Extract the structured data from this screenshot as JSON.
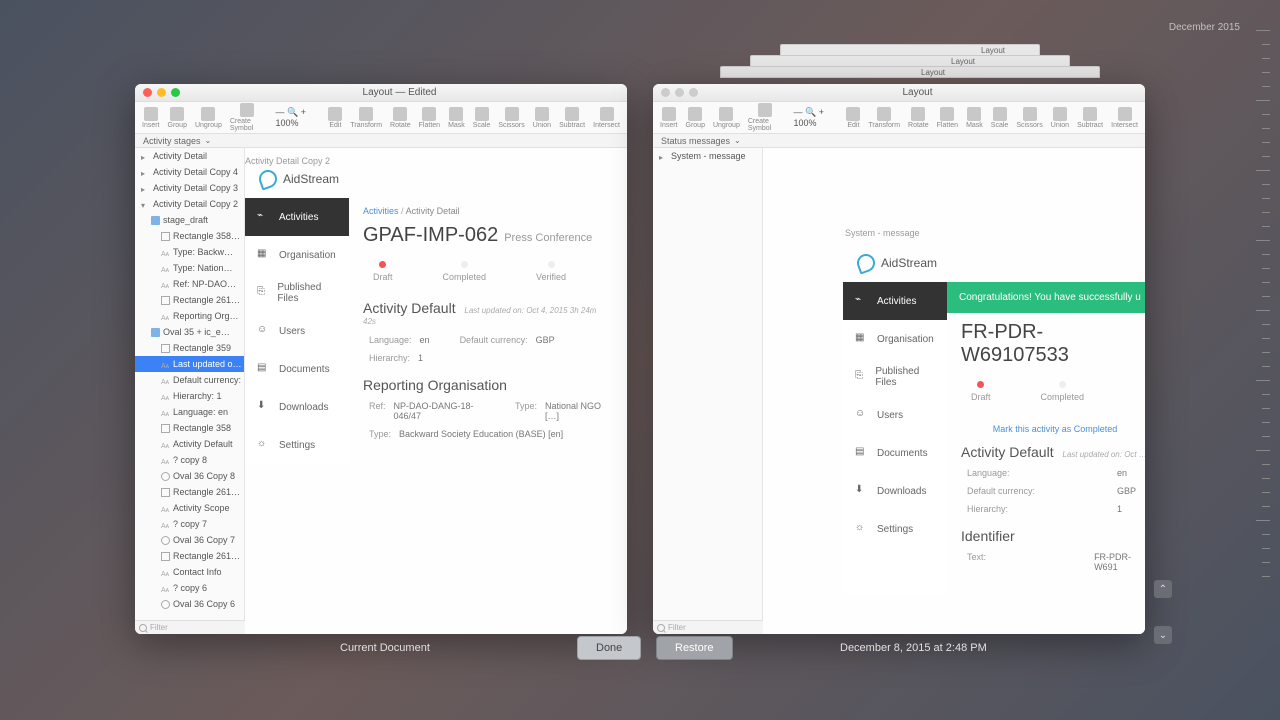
{
  "corner_date": "December 2015",
  "bg_tab_label": "Layout",
  "left_window": {
    "title": "Layout — Edited",
    "subbar": "Activity stages",
    "canvas_crumb": "Activity Detail Copy 2"
  },
  "right_window": {
    "title": "Layout",
    "subbar": "Status messages",
    "layer_root": "System - message",
    "canvas_crumb": "System - message"
  },
  "toolbar": [
    "Insert",
    "Group",
    "Ungroup",
    "Create Symbol",
    "Edit",
    "Transform",
    "Rotate",
    "Flatten",
    "Mask",
    "Scale",
    "Scissors",
    "Union",
    "Subtract",
    "Intersect"
  ],
  "zoom": "100%",
  "layers": [
    {
      "lvl": 0,
      "ic": "tri",
      "txt": "Activity Detail"
    },
    {
      "lvl": 0,
      "ic": "tri",
      "txt": "Activity Detail Copy 4"
    },
    {
      "lvl": 0,
      "ic": "tri",
      "txt": "Activity Detail Copy 3"
    },
    {
      "lvl": 0,
      "ic": "tri open",
      "txt": "Activity Detail Copy 2"
    },
    {
      "lvl": 1,
      "ic": "folder",
      "txt": "stage_draft"
    },
    {
      "lvl": 2,
      "ic": "rect",
      "txt": "Rectangle 358…"
    },
    {
      "lvl": 2,
      "ic": "text",
      "txt": "Type:   Backw…"
    },
    {
      "lvl": 2,
      "ic": "text",
      "txt": "Type:   Nation…"
    },
    {
      "lvl": 2,
      "ic": "text",
      "txt": "Ref:   NP-DAO…"
    },
    {
      "lvl": 2,
      "ic": "rect",
      "txt": "Rectangle 261…"
    },
    {
      "lvl": 2,
      "ic": "text",
      "txt": "Reporting Org…"
    },
    {
      "lvl": 1,
      "ic": "folder",
      "txt": "Oval 35 + ic_e…"
    },
    {
      "lvl": 2,
      "ic": "rect",
      "txt": "Rectangle 359"
    },
    {
      "lvl": 2,
      "ic": "text",
      "txt": "Last updated o…",
      "sel": true
    },
    {
      "lvl": 2,
      "ic": "text",
      "txt": "Default currency:"
    },
    {
      "lvl": 2,
      "ic": "text",
      "txt": "Hierarchy:   1"
    },
    {
      "lvl": 2,
      "ic": "text",
      "txt": "Language:   en"
    },
    {
      "lvl": 2,
      "ic": "rect",
      "txt": "Rectangle 358"
    },
    {
      "lvl": 2,
      "ic": "text",
      "txt": "Activity Default"
    },
    {
      "lvl": 2,
      "ic": "text",
      "txt": "? copy 8"
    },
    {
      "lvl": 2,
      "ic": "oval",
      "txt": "Oval 36 Copy 8"
    },
    {
      "lvl": 2,
      "ic": "rect",
      "txt": "Rectangle 261…"
    },
    {
      "lvl": 2,
      "ic": "text",
      "txt": "Activity Scope"
    },
    {
      "lvl": 2,
      "ic": "text",
      "txt": "? copy 7"
    },
    {
      "lvl": 2,
      "ic": "oval",
      "txt": "Oval 36 Copy 7"
    },
    {
      "lvl": 2,
      "ic": "rect",
      "txt": "Rectangle 261…"
    },
    {
      "lvl": 2,
      "ic": "text",
      "txt": "Contact Info"
    },
    {
      "lvl": 2,
      "ic": "text",
      "txt": "? copy 6"
    },
    {
      "lvl": 2,
      "ic": "oval",
      "txt": "Oval 36 Copy 6"
    }
  ],
  "filter_placeholder": "Filter",
  "brand": "AidStream",
  "nav": [
    "Activities",
    "Organisation",
    "Published Files",
    "Users",
    "Documents",
    "Downloads",
    "Settings"
  ],
  "mockup1": {
    "breadcrumb": {
      "a": "Activities",
      "b": "Activity Detail"
    },
    "title": "GPAF-IMP-062",
    "subtitle": "Press Conference",
    "stages": [
      "Draft",
      "Completed",
      "Verified"
    ],
    "active_stage": 0,
    "default_title": "Activity Default",
    "updated": "Last updated on:   Oct 4, 2015 3h 24m 42s",
    "lang_k": "Language:",
    "lang_v": "en",
    "curr_k": "Default currency:",
    "curr_v": "GBP",
    "hier_k": "Hierarchy:",
    "hier_v": "1",
    "rep_title": "Reporting Organisation",
    "ref_k": "Ref:",
    "ref_v": "NP-DAO-DANG-18-046/47",
    "type_k": "Type:",
    "type_v": "National NGO […]",
    "type2_k": "Type:",
    "type2_v": "Backward Society Education (BASE) [en]"
  },
  "mockup2": {
    "success": "Congratulations! You have successfully u",
    "title": "FR-PDR-W69107533",
    "stages": [
      "Draft",
      "Completed"
    ],
    "mark_complete": "Mark this activity as Completed",
    "default_title": "Activity Default",
    "updated": "Last updated on:   Oct …",
    "lang_k": "Language:",
    "lang_v": "en",
    "curr_k": "Default currency:",
    "curr_v": "GBP",
    "hier_k": "Hierarchy:",
    "hier_v": "1",
    "ident_title": "Identifier",
    "text_k": "Text:",
    "text_v": "FR-PDR-W691"
  },
  "footer": {
    "left_label": "Current Document",
    "right_label": "December 8, 2015 at 2:48 PM",
    "done": "Done",
    "restore": "Restore"
  }
}
